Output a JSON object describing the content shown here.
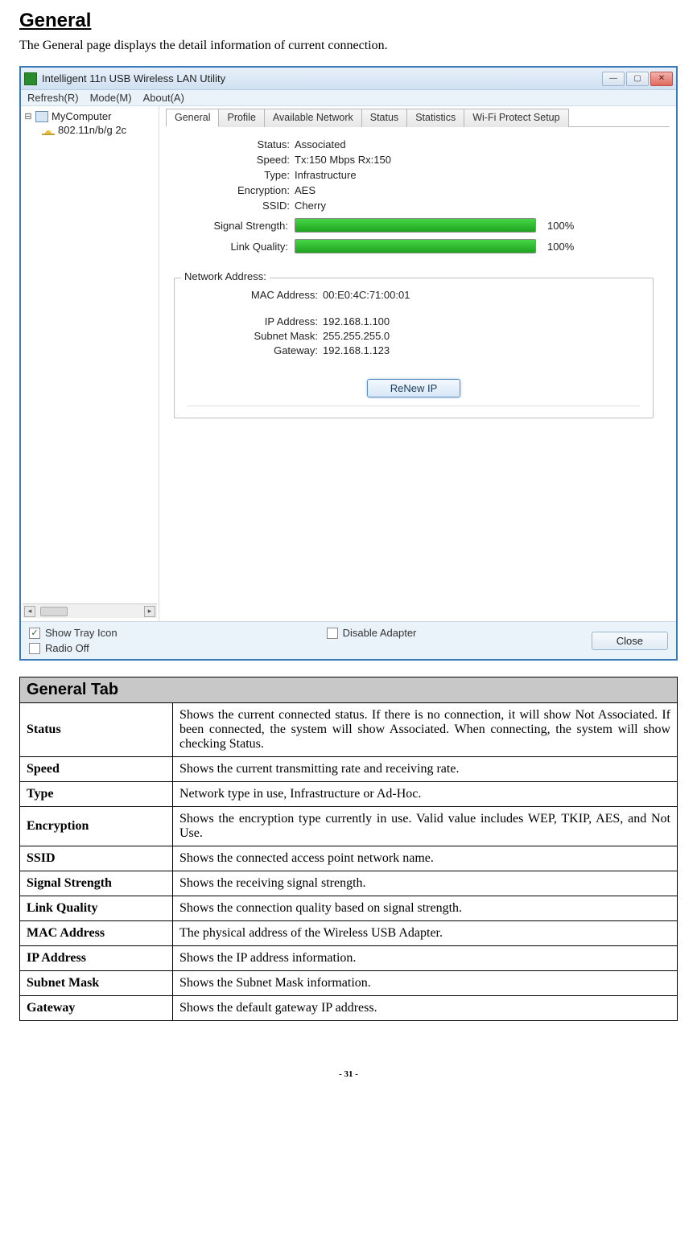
{
  "heading": "General",
  "intro": "The General page displays the detail information of current connection.",
  "window": {
    "title": "Intelligent 11n USB Wireless LAN Utility",
    "menu": {
      "refresh": "Refresh(R)",
      "mode": "Mode(M)",
      "about": "About(A)"
    },
    "tree": {
      "root": "MyComputer",
      "child": "802.11n/b/g 2c"
    },
    "tabs": {
      "general": "General",
      "profile": "Profile",
      "available": "Available Network",
      "status": "Status",
      "statistics": "Statistics",
      "wps": "Wi-Fi Protect Setup"
    },
    "info": {
      "status_label": "Status:",
      "status_value": "Associated",
      "speed_label": "Speed:",
      "speed_value": "Tx:150 Mbps Rx:150",
      "type_label": "Type:",
      "type_value": "Infrastructure",
      "encryption_label": "Encryption:",
      "encryption_value": "AES",
      "ssid_label": "SSID:",
      "ssid_value": "Cherry",
      "signal_label": "Signal Strength:",
      "signal_pct": "100%",
      "link_label": "Link Quality:",
      "link_pct": "100%"
    },
    "network_address": {
      "legend": "Network Address:",
      "mac_label": "MAC Address:",
      "mac_value": "00:E0:4C:71:00:01",
      "ip_label": "IP Address:",
      "ip_value": "192.168.1.100",
      "subnet_label": "Subnet Mask:",
      "subnet_value": "255.255.255.0",
      "gateway_label": "Gateway:",
      "gateway_value": "192.168.1.123",
      "renew_button": "ReNew IP"
    },
    "bottom": {
      "show_tray": "Show Tray Icon",
      "radio_off": "Radio Off",
      "disable_adapter": "Disable Adapter",
      "close": "Close"
    }
  },
  "table": {
    "header": "General Tab",
    "rows": [
      {
        "term": "Status",
        "def": "Shows the current connected status. If there is no connection, it will show Not Associated. If been connected, the system will show Associated. When connecting, the system will show checking Status."
      },
      {
        "term": "Speed",
        "def": "Shows the current transmitting rate and receiving rate."
      },
      {
        "term": "Type",
        "def": "Network type in use, Infrastructure or Ad-Hoc."
      },
      {
        "term": "Encryption",
        "def": "Shows the encryption type currently in use. Valid value includes WEP, TKIP, AES, and Not Use."
      },
      {
        "term": "SSID",
        "def": "Shows the connected access point network name."
      },
      {
        "term": "Signal Strength",
        "def": "Shows the receiving signal strength."
      },
      {
        "term": "Link Quality",
        "def": "Shows the connection quality based on signal strength."
      },
      {
        "term": "MAC Address",
        "def": "The physical address of the Wireless USB Adapter."
      },
      {
        "term": "IP Address",
        "def": "Shows the IP address information."
      },
      {
        "term": "Subnet Mask",
        "def": "Shows the Subnet Mask information."
      },
      {
        "term": "Gateway",
        "def": "Shows the default gateway IP address."
      }
    ]
  },
  "page_number": "- 31 -"
}
